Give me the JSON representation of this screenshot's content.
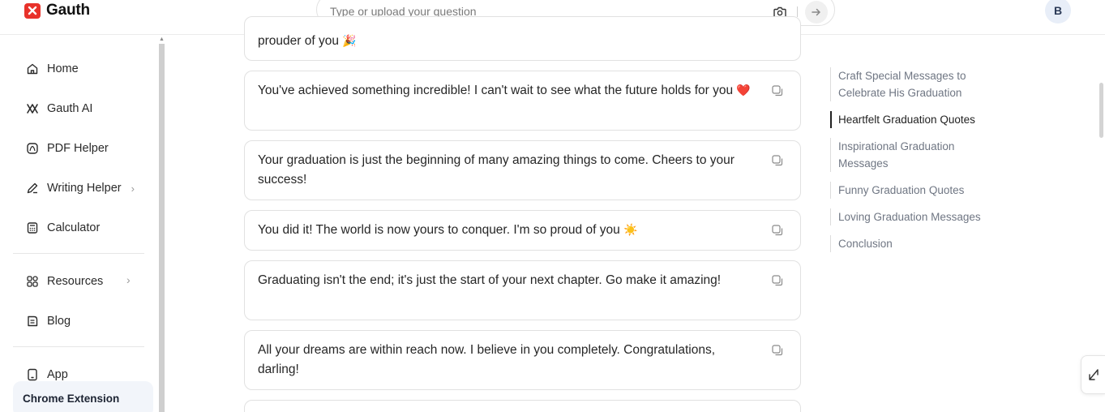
{
  "header": {
    "brand": "Gauth",
    "search_placeholder": "Type or upload your question",
    "avatar_initial": "B"
  },
  "sidebar": {
    "items": [
      {
        "label": "Home",
        "icon": "home-icon"
      },
      {
        "label": "Gauth AI",
        "icon": "gauth-ai-icon"
      },
      {
        "label": "PDF Helper",
        "icon": "pdf-icon"
      },
      {
        "label": "Writing Helper",
        "icon": "pen-icon",
        "has_submenu": true
      },
      {
        "label": "Calculator",
        "icon": "calculator-icon"
      }
    ],
    "resources": {
      "label": "Resources",
      "icon": "grid-icon",
      "has_submenu": true
    },
    "blog": {
      "label": "Blog",
      "icon": "blog-icon"
    },
    "app": {
      "label": "App",
      "icon": "phone-icon"
    },
    "chrome_extension": "Chrome Extension"
  },
  "messages": [
    {
      "text": "prouder of you",
      "emoji": "🎉"
    },
    {
      "text": "You've achieved something incredible! I can't wait to see what the future holds for you",
      "emoji": "❤️"
    },
    {
      "text": "Your graduation is just the beginning of many amazing things to come. Cheers to your success!",
      "emoji": ""
    },
    {
      "text": "You did it! The world is now yours to conquer. I'm so proud of you",
      "emoji": "☀️"
    },
    {
      "text": "Graduating isn't the end; it's just the start of your next chapter. Go make it amazing!",
      "emoji": ""
    },
    {
      "text": "All your dreams are within reach now. I believe in you completely. Congratulations, darling!",
      "emoji": ""
    }
  ],
  "toc": {
    "items": [
      "Craft Special Messages to Celebrate His Graduation",
      "Heartfelt Graduation Quotes",
      "Inspirational Graduation Messages",
      "Funny Graduation Quotes",
      "Loving Graduation Messages",
      "Conclusion"
    ],
    "active": "Heartfelt Graduation Quotes"
  },
  "colors": {
    "brand": "#e8322b",
    "heart": "#e02424",
    "toc_text": "#6f7683"
  }
}
